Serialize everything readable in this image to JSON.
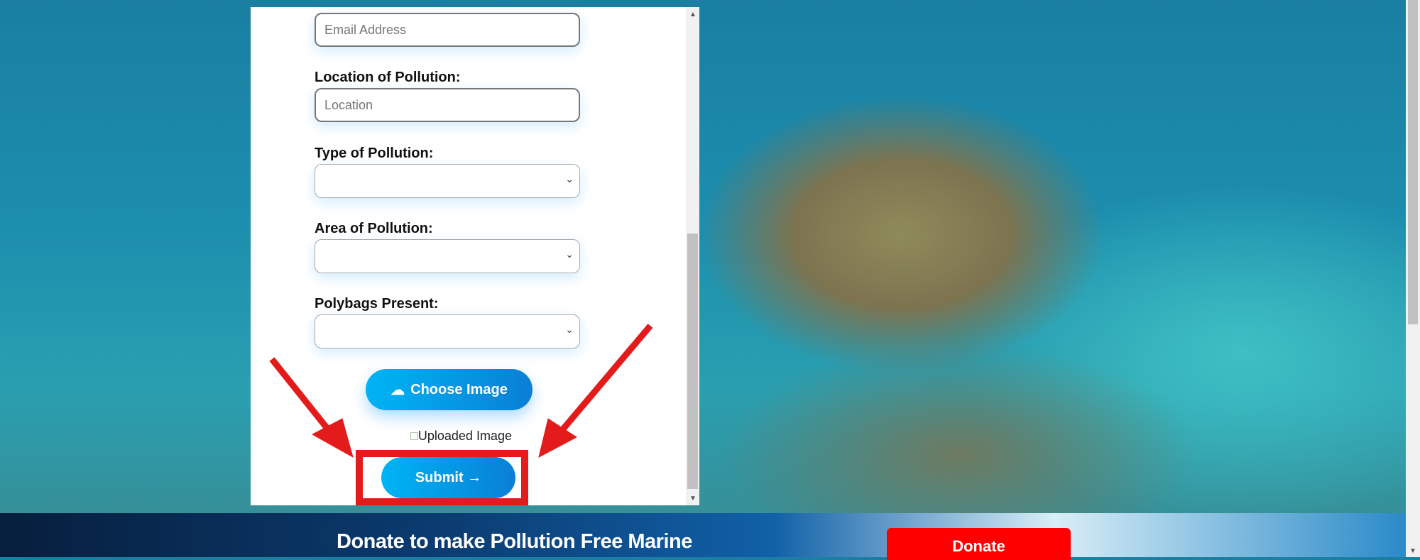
{
  "form": {
    "email_placeholder": "Email Address",
    "location_label": "Location of Pollution:",
    "location_placeholder": "Location",
    "type_label": "Type of Pollution:",
    "area_label": "Area of Pollution:",
    "polybags_label": "Polybags Present:",
    "choose_image": "Choose Image",
    "uploaded_image_alt": "Uploaded Image",
    "submit": "Submit →"
  },
  "banner": {
    "text": "Donate to make Pollution Free Marine",
    "donate": "Donate"
  },
  "colors": {
    "accent": "#0a9be8",
    "annotation": "#e31b1b",
    "donate": "#ff0000"
  }
}
